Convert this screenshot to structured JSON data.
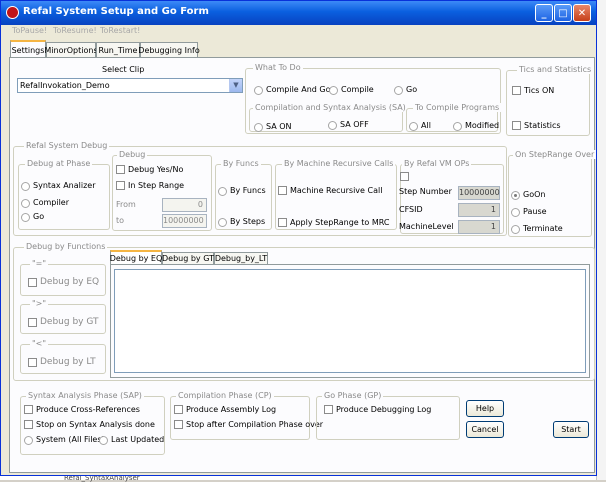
{
  "window": {
    "title": "Refal System Setup and Go Form"
  },
  "title_buttons": {
    "minimize": "_",
    "maximize": "□",
    "close": "✕"
  },
  "menu": [
    "ToPause!",
    "ToResume!",
    "ToRestart!"
  ],
  "tabs": [
    "Settings",
    "MinorOptions",
    "Run_Time",
    "Debugging Info"
  ],
  "select_clip": {
    "label": "Select  Clip",
    "value": "RefalInvokation_Demo"
  },
  "what_to_do": {
    "label": "What To Do",
    "options": [
      "Compile And Go",
      "Compile",
      "Go"
    ]
  },
  "compilation_syntax": {
    "label": "Compilation  and  Syntax Analysis (SA)",
    "options": [
      "SA  ON",
      "SA  OFF"
    ]
  },
  "to_compile": {
    "label": "To Compile  Programs",
    "options": [
      "All",
      "Modified"
    ]
  },
  "tics": {
    "label": "Tics and Statistics",
    "tics_on": "Tics ON",
    "statistics": "Statistics"
  },
  "refal_debug": {
    "label": "Refal System Debug"
  },
  "debug_at_phase": {
    "label": "Debug  at  Phase",
    "options": [
      "Syntax Analizer",
      "Compiler",
      "Go"
    ]
  },
  "debug": {
    "label": "Debug",
    "yes_no": "Debug Yes/No",
    "in_step_range": "In Step Range",
    "from_label": "From",
    "from_value": "0",
    "to_label": "to",
    "to_value": "10000000"
  },
  "by_funcs": {
    "label": "By Funcs",
    "options": [
      "By Funcs",
      "By Steps"
    ]
  },
  "by_mrc": {
    "label": "By Machine Recursive Calls",
    "machine_recursive_call": "Machine  Recursive Call",
    "apply_step_range": "Apply StepRange to MRC"
  },
  "by_refal_vm": {
    "label": "By Refal VM OPs",
    "fields": [
      {
        "label": "Step Number",
        "value": "10000000"
      },
      {
        "label": "CFSID",
        "value": "1"
      },
      {
        "label": "MachineLevel",
        "value": "1"
      }
    ]
  },
  "on_step_range_over": {
    "label": "On StepRange Over",
    "options": [
      "GoOn",
      "Pause",
      "Terminate"
    ]
  },
  "debug_by_functions": {
    "label": "Debug by Functions",
    "groups": [
      {
        "title": "\"=\"",
        "check": "Debug by  EQ"
      },
      {
        "title": "\">\"",
        "check": "Debug by  GT"
      },
      {
        "title": "\"<\"",
        "check": "Debug by  LT"
      }
    ]
  },
  "debug_tabs": [
    "Debug by EQ",
    "Debug by GT",
    "Debug_by_LT"
  ],
  "sap": {
    "label": "Syntax Analysis Phase (SAP)",
    "produce_cross": "Produce Cross-References",
    "stop_on_sa": "Stop on Syntax Analysis done",
    "options": [
      "System (All Files)",
      "Last Updated"
    ]
  },
  "cp": {
    "label": "Compilation Phase (CP)",
    "produce_assembly": "Produce Assembly Log",
    "stop_after": "Stop after Compilation Phase over"
  },
  "gp": {
    "label": "Go Phase (GP)",
    "produce_debugging": "Produce Debugging Log"
  },
  "buttons": {
    "help": "Help",
    "cancel": "Cancel",
    "start": "Start"
  },
  "taskbar": {
    "item": "Refal_SyntaxAnalyser"
  }
}
